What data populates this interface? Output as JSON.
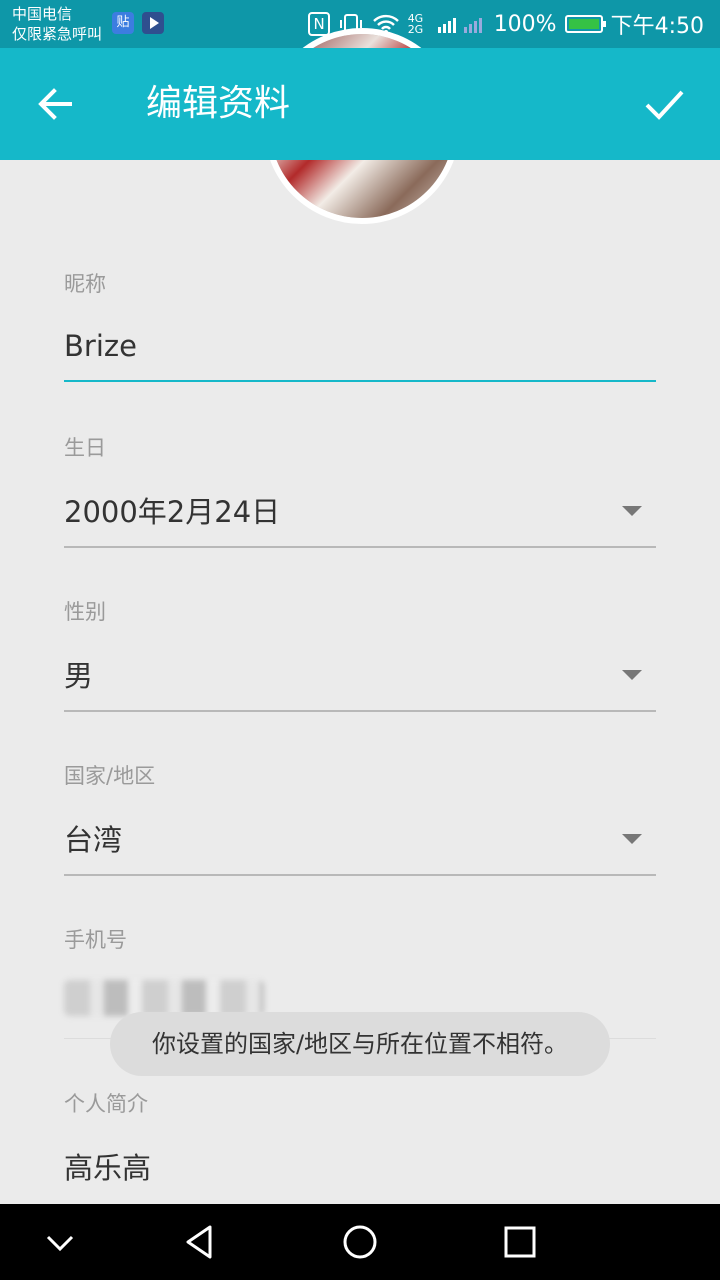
{
  "status_bar": {
    "carrier_line1": "中国电信",
    "carrier_line2": "仅限紧急呼叫",
    "app_icon_1": "贴",
    "nfc": "N",
    "network": "4G 2G",
    "battery_percent": "100%",
    "time": "下午4:50"
  },
  "app_bar": {
    "title": "编辑资料",
    "back_icon": "arrow-left-icon",
    "confirm_icon": "check-icon",
    "color": "#15b8c9"
  },
  "form": {
    "nickname": {
      "label": "昵称",
      "value": "Brize"
    },
    "birthday": {
      "label": "生日",
      "value": "2000年2月24日"
    },
    "gender": {
      "label": "性别",
      "value": "男"
    },
    "region": {
      "label": "国家/地区",
      "value": "台湾"
    },
    "phone": {
      "label": "手机号"
    },
    "bio": {
      "label": "个人简介",
      "value": "高乐高"
    }
  },
  "toast": {
    "text": "你设置的国家/地区与所在位置不相符。"
  },
  "nav_bar": {
    "buttons": [
      "chevron-down-icon",
      "back-triangle-icon",
      "home-circle-icon",
      "recents-square-icon"
    ]
  }
}
